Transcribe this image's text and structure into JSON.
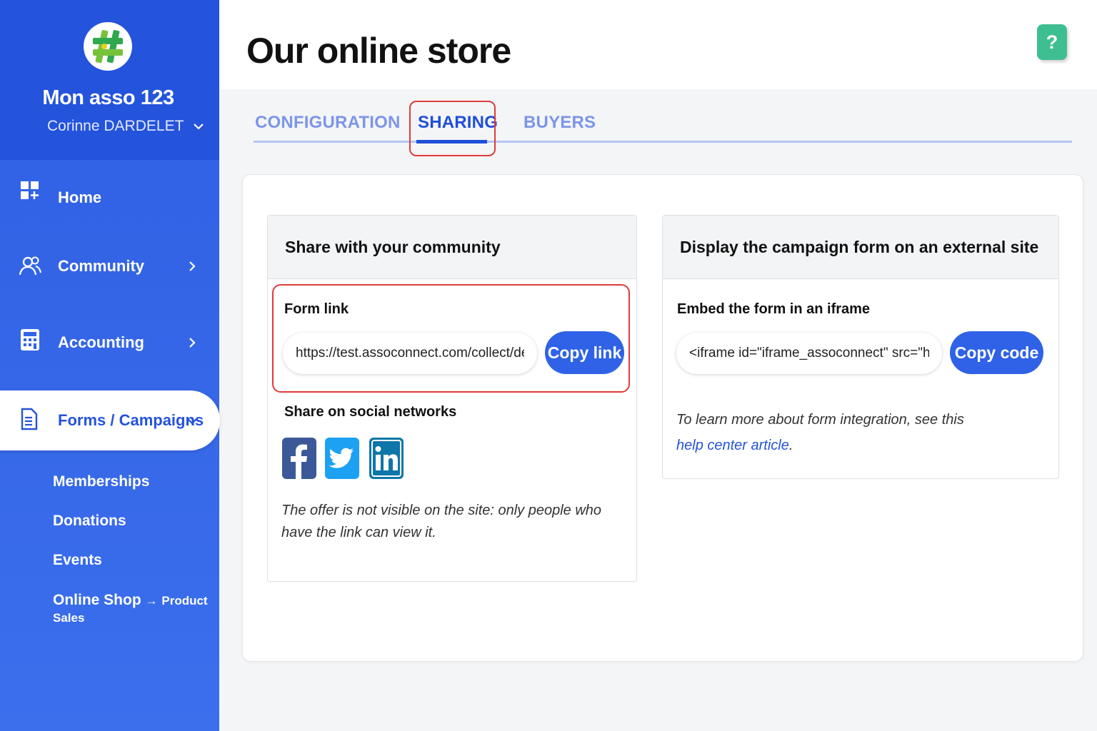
{
  "sidebar": {
    "org_name": "Mon asso 123",
    "user_name": "Corinne DARDELET",
    "nav": {
      "home": "Home",
      "community": "Community",
      "accounting": "Accounting",
      "forms_campaigns": "Forms / Campaigns"
    },
    "sub_items": {
      "memberships": "Memberships",
      "donations": "Donations",
      "events": "Events",
      "online_shop": "Online Shop",
      "online_shop_arrow": "→",
      "online_shop_suffix": "Product Sales"
    },
    "colors": {
      "background": "#2f5ee3",
      "active_text": "#2453dc"
    }
  },
  "header": {
    "title": "Our online store",
    "help_label": "?"
  },
  "tabs": {
    "configuration": "CONFIGURATION",
    "sharing": "SHARING",
    "buyers": "BUYERS",
    "active": "SHARING"
  },
  "share_panel": {
    "title": "Share with your community",
    "form_link_label": "Form link",
    "form_link_value": "https://test.assoconnect.com/collect/descr",
    "copy_link_label": "Copy link",
    "social_title": "Share on social networks",
    "social_icons": [
      "facebook-icon",
      "twitter-icon",
      "linkedin-icon"
    ],
    "note": "The offer is not visible on the site: only people who have the link can view it."
  },
  "embed_panel": {
    "title": "Display the campaign form on an external site",
    "iframe_label": "Embed the form in an iframe",
    "iframe_value": "<iframe id=\"iframe_assoconnect\" src=\"http",
    "copy_code_label": "Copy code",
    "note_prefix": "To learn more about form integration, see this ",
    "note_link": "help center article",
    "note_suffix": "."
  },
  "colors": {
    "accent": "#2f62e6",
    "highlight": "#e03b3b",
    "help": "#3fbe92",
    "facebook": "#3b5998",
    "twitter": "#1da1f2",
    "linkedin": "#0e76a8"
  }
}
